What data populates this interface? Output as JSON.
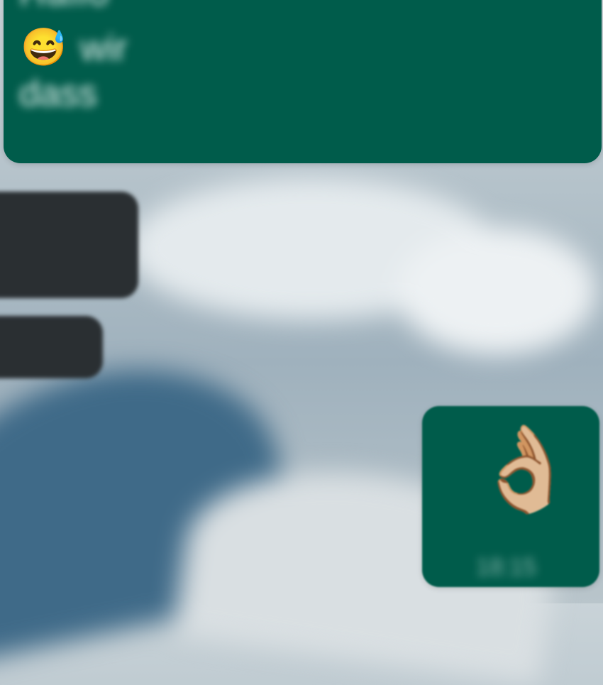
{
  "messages": {
    "outgoing_top": {
      "line1": "Hallo",
      "emoji": "😅",
      "line2_rest": "wir",
      "line3": "dass"
    },
    "incoming_1": {
      "line1": "",
      "line2": ""
    },
    "incoming_2": {
      "line1": ""
    },
    "outgoing_bottom": {
      "emoji": "👌🏼",
      "time": "18:15"
    }
  }
}
